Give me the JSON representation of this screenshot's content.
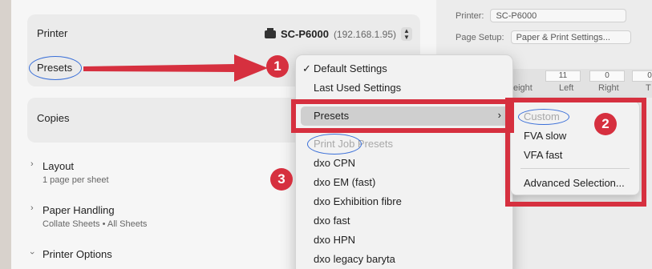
{
  "background_app": {
    "printer_label": "Printer:",
    "printer_value": "SC-P6000",
    "page_setup_label": "Page Setup:",
    "page_setup_value": "Paper & Print Settings...",
    "fields": [
      "11",
      "0",
      "0"
    ],
    "field_labels": [
      "eight",
      "Left",
      "Right",
      "T"
    ]
  },
  "dialog": {
    "printer_label": "Printer",
    "printer_name": "SC-P6000",
    "printer_ip": "(192.168.1.95)",
    "presets_label": "Presets",
    "copies_label": "Copies",
    "layout": {
      "title": "Layout",
      "subtitle": "1 page per sheet"
    },
    "paper_handling": {
      "title": "Paper Handling",
      "subtitle": "Collate Sheets • All Sheets"
    },
    "printer_options": {
      "title": "Printer Options"
    }
  },
  "menu": {
    "items": [
      {
        "label": "Default Settings",
        "checked": true
      },
      {
        "label": "Last Used Settings"
      },
      {
        "label": "Presets",
        "highlighted": true,
        "has_submenu": true
      },
      {
        "label": "Print Job Presets",
        "disabled": true
      },
      {
        "label": "dxo CPN"
      },
      {
        "label": "dxo EM (fast)"
      },
      {
        "label": "dxo Exhibition fibre"
      },
      {
        "label": "dxo fast"
      },
      {
        "label": "dxo HPN"
      },
      {
        "label": "dxo legacy baryta"
      }
    ],
    "check_glyph": "✓",
    "submenu_glyph": "›"
  },
  "submenu": {
    "items": [
      {
        "label": "Custom",
        "disabled": true
      },
      {
        "label": "FVA slow"
      },
      {
        "label": "VFA fast"
      },
      {
        "label": "Advanced Selection..."
      }
    ]
  },
  "annotations": {
    "badges": [
      "1",
      "2",
      "3"
    ],
    "accent": "#d6303f",
    "oval_color": "#3a6fd8"
  }
}
